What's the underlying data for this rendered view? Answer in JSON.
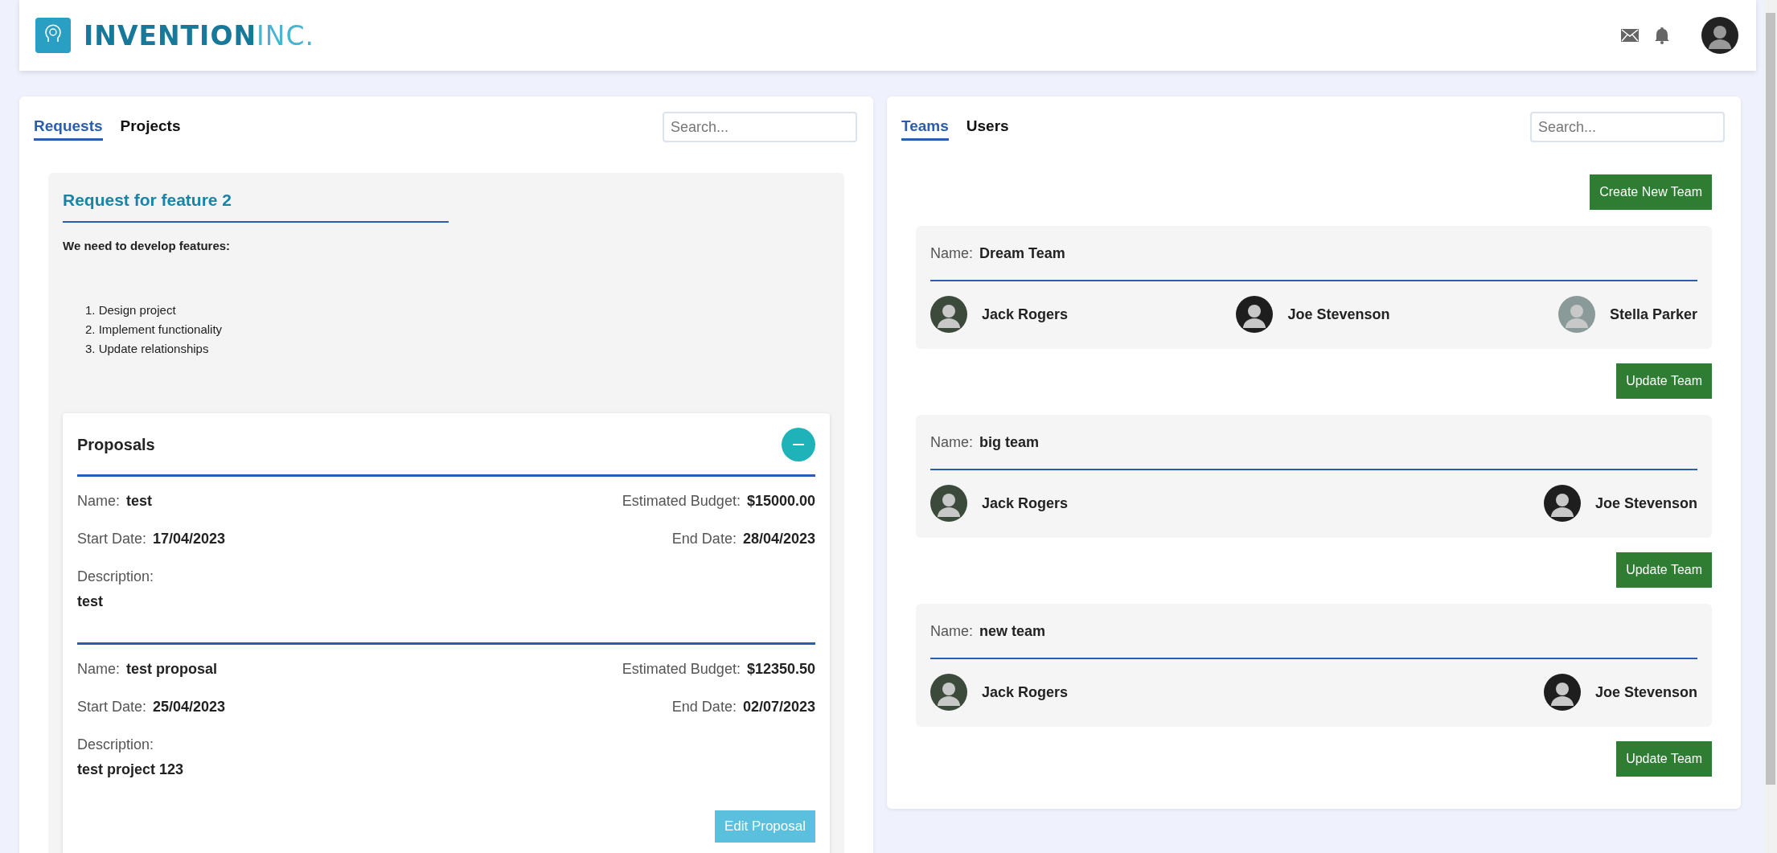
{
  "header": {
    "logo": {
      "name": "INVENTION",
      "suffix": "INC."
    }
  },
  "left_panel": {
    "tabs": [
      {
        "label": "Requests",
        "selected": true
      },
      {
        "label": "Projects",
        "selected": false
      }
    ],
    "search": {
      "placeholder": "Search..."
    },
    "request": {
      "title": "Request for feature 2",
      "intro": "We need to develop features:",
      "steps": [
        "1. Design project",
        "2. Implement functionality",
        "3. Update relationships"
      ],
      "proposals": {
        "title": "Proposals",
        "expanded": true,
        "items": [
          {
            "name_label": "Name:",
            "name": "test",
            "budget_label": "Estimated Budget:",
            "budget": "$15000.00",
            "start_label": "Start Date:",
            "start": "17/04/2023",
            "end_label": "End Date:",
            "end": "28/04/2023",
            "description_label": "Description:",
            "description": "test"
          },
          {
            "name_label": "Name:",
            "name": "test proposal",
            "budget_label": "Estimated Budget:",
            "budget": "$12350.50",
            "start_label": "Start Date:",
            "start": "25/04/2023",
            "end_label": "End Date:",
            "end": "02/07/2023",
            "description_label": "Description:",
            "description": "test project 123"
          }
        ],
        "edit_button": "Edit Proposal"
      }
    }
  },
  "right_panel": {
    "tabs": [
      {
        "label": "Teams",
        "selected": true
      },
      {
        "label": "Users",
        "selected": false
      }
    ],
    "search": {
      "placeholder": "Search..."
    },
    "create_button": "Create New Team",
    "teams": [
      {
        "name_label": "Name:",
        "name": "Dream Team",
        "members": [
          "Jack Rogers",
          "Joe Stevenson",
          "Stella Parker"
        ],
        "button": "Update Team"
      },
      {
        "name_label": "Name:",
        "name": "big team",
        "members": [
          "Jack Rogers",
          "Joe Stevenson"
        ],
        "button": "Update Team"
      },
      {
        "name_label": "Name:",
        "name": "new team",
        "members": [
          "Jack Rogers",
          "Joe Stevenson"
        ],
        "button": "Update Team"
      }
    ]
  }
}
